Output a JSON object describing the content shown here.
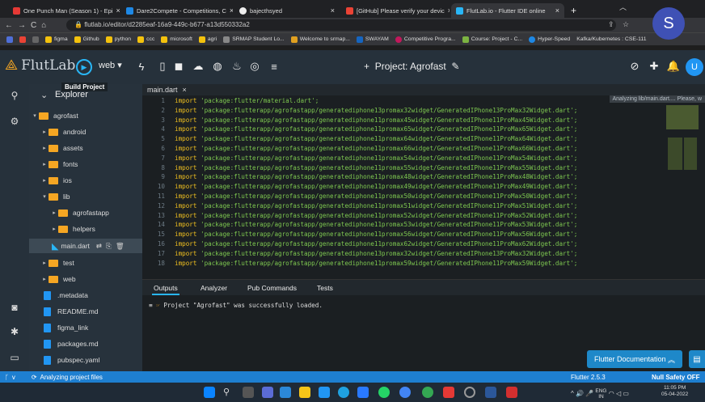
{
  "browser": {
    "tabs": [
      {
        "title": "One Punch Man (Season 1) - Epi"
      },
      {
        "title": "Dare2Compete - Competitions, C"
      },
      {
        "title": "bajecthsyed"
      },
      {
        "title": "[GitHub] Please verify your devic"
      },
      {
        "title": "FlutLab.io - Flutter IDE online"
      }
    ],
    "new_tab": "+",
    "url": "flutlab.io/editor/d2285eaf-16a9-449c-b677-a13d550332a2",
    "profile_initial": "S",
    "bookmarks": [
      "figma",
      "Github",
      "python",
      "ccc",
      "microsoft",
      "agri",
      "SRMAP Student Lo...",
      "Welcome to srmap...",
      "SWAYAM",
      "Competitive Progra...",
      "Course: Project - C...",
      "Hyper-Speed"
    ],
    "bookmark_overflow": "Kafka/Kubernetes : CSE-111"
  },
  "app": {
    "logo_text": "FlutLab",
    "target": "web",
    "project_title": "Project: Agrofast",
    "avatar": "U",
    "tooltip": "Build Project"
  },
  "explorer": {
    "title": "Explorer",
    "items": [
      {
        "label": "agrofast"
      },
      {
        "label": "android"
      },
      {
        "label": "assets"
      },
      {
        "label": "fonts"
      },
      {
        "label": "ios"
      },
      {
        "label": "lib"
      },
      {
        "label": "agrofastapp"
      },
      {
        "label": "helpers"
      },
      {
        "label": "main.dart"
      },
      {
        "label": "test"
      },
      {
        "label": "web"
      },
      {
        "label": ".metadata"
      },
      {
        "label": "README.md"
      },
      {
        "label": "figma_link"
      },
      {
        "label": "packages.md"
      },
      {
        "label": "pubspec.yaml"
      }
    ]
  },
  "editor": {
    "tab": "main.dart",
    "analyzing": "Analyzing lib/main.dart.... Please, w",
    "keyword": "import",
    "lines": [
      "'package:flutter/material.dart';",
      "'package:flutterapp/agrofastapp/generatediphone13promax32widget/GeneratedIPhone13ProMax32Widget.dart';",
      "'package:flutterapp/agrofastapp/generatediphone11promax45widget/GeneratedIPhone11ProMax45Widget.dart';",
      "'package:flutterapp/agrofastapp/generatediphone11promax65widget/GeneratedIPhone11ProMax65Widget.dart';",
      "'package:flutterapp/agrofastapp/generatediphone11promax64widget/GeneratedIPhone11ProMax64Widget.dart';",
      "'package:flutterapp/agrofastapp/generatediphone11promax66widget/GeneratedIPhone11ProMax66Widget.dart';",
      "'package:flutterapp/agrofastapp/generatediphone11promax54widget/GeneratedIPhone11ProMax54Widget.dart';",
      "'package:flutterapp/agrofastapp/generatediphone11promax55widget/GeneratedIPhone11ProMax55Widget.dart';",
      "'package:flutterapp/agrofastapp/generatediphone11promax48widget/GeneratedIPhone11ProMax48Widget.dart';",
      "'package:flutterapp/agrofastapp/generatediphone11promax49widget/GeneratedIPhone11ProMax49Widget.dart';",
      "'package:flutterapp/agrofastapp/generatediphone11promax50widget/GeneratedIPhone11ProMax50Widget.dart';",
      "'package:flutterapp/agrofastapp/generatediphone11promax51widget/GeneratedIPhone11ProMax51Widget.dart';",
      "'package:flutterapp/agrofastapp/generatediphone11promax52widget/GeneratedIPhone11ProMax52Widget.dart';",
      "'package:flutterapp/agrofastapp/generatediphone11promax53widget/GeneratedIPhone11ProMax53Widget.dart';",
      "'package:flutterapp/agrofastapp/generatediphone11promax56widget/GeneratedIPhone11ProMax56Widget.dart';",
      "'package:flutterapp/agrofastapp/generatediphone11promax62widget/GeneratedIPhone11ProMax62Widget.dart';",
      "'package:flutterapp/agrofastapp/generatediphone13promax32widget/GeneratedIPhone13ProMax32Widget.dart';",
      "'package:flutterapp/agrofastapp/generatediphone11promax59widget/GeneratedIPhone11ProMax59Widget.dart';"
    ]
  },
  "output": {
    "tabs": [
      "Outputs",
      "Analyzer",
      "Pub Commands",
      "Tests"
    ],
    "message": "Project \"Agrofast\" was successfully loaded."
  },
  "status": {
    "left": "Analyzing project files",
    "branch": "v",
    "flutter_version": "Flutter 2.5.3",
    "null_safety": "Null Safety OFF",
    "doc_button": "Flutter Documentation"
  },
  "taskbar": {
    "lang": "ENG",
    "region": "IN",
    "time": "11:05 PM",
    "date": "05-04-2022"
  },
  "colors": {
    "accent": "#29b6f6",
    "folder": "#f5a623",
    "status": "#1e7fd0",
    "string": "#7ec850",
    "keyword": "#f0c020"
  }
}
